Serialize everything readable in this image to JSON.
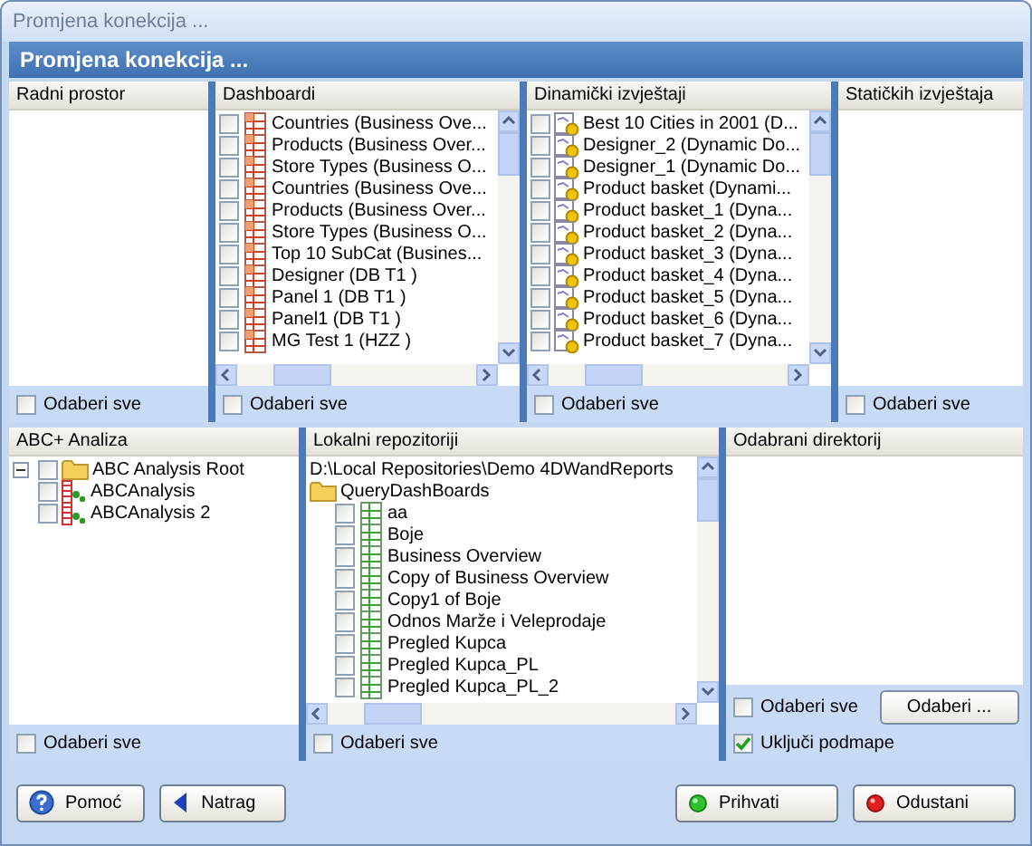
{
  "window": {
    "title": "Promjena konekcija ..."
  },
  "banner": {
    "title": "Promjena konekcija ..."
  },
  "top_panels": [
    {
      "title": "Radni prostor",
      "scrollable": false,
      "select_all": {
        "label": "Odaberi sve",
        "checked": false
      }
    },
    {
      "title": "Dashboardi",
      "scrollable": true,
      "items": [
        {
          "label": "Countries (Business Ove...",
          "kind": "dashboard",
          "checked": false
        },
        {
          "label": "Products (Business Over...",
          "kind": "dashboard",
          "checked": false
        },
        {
          "label": "Store Types (Business O...",
          "kind": "dashboard",
          "checked": false
        },
        {
          "label": "Countries (Business Ove...",
          "kind": "dashboard",
          "checked": false
        },
        {
          "label": "Products (Business Over...",
          "kind": "dashboard",
          "checked": false
        },
        {
          "label": "Store Types (Business O...",
          "kind": "dashboard",
          "checked": false
        },
        {
          "label": "Top 10 SubCat (Busines...",
          "kind": "dashboard",
          "checked": false
        },
        {
          "label": "Designer (DB T1 )",
          "kind": "dashboard",
          "checked": false
        },
        {
          "label": "Panel 1 (DB T1 )",
          "kind": "dashboard",
          "checked": false
        },
        {
          "label": "Panel1 (DB T1 )",
          "kind": "dashboard",
          "checked": false
        },
        {
          "label": "MG Test 1 (HZZ )",
          "kind": "dashboard",
          "checked": false
        }
      ],
      "select_all": {
        "label": "Odaberi sve",
        "checked": false
      }
    },
    {
      "title": "Dinamički izvještaji",
      "scrollable": true,
      "items": [
        {
          "label": "Best 10 Cities in 2001 (D...",
          "kind": "dynamic",
          "checked": false
        },
        {
          "label": "Designer_2 (Dynamic Do...",
          "kind": "dynamic",
          "checked": false
        },
        {
          "label": "Designer_1 (Dynamic Do...",
          "kind": "dynamic",
          "checked": false
        },
        {
          "label": "Product basket (Dynami...",
          "kind": "dynamic",
          "checked": false
        },
        {
          "label": "Product basket_1 (Dyna...",
          "kind": "dynamic",
          "checked": false
        },
        {
          "label": "Product basket_2 (Dyna...",
          "kind": "dynamic",
          "checked": false
        },
        {
          "label": "Product basket_3 (Dyna...",
          "kind": "dynamic",
          "checked": false
        },
        {
          "label": "Product basket_4 (Dyna...",
          "kind": "dynamic",
          "checked": false
        },
        {
          "label": "Product basket_5 (Dyna...",
          "kind": "dynamic",
          "checked": false
        },
        {
          "label": "Product basket_6 (Dyna...",
          "kind": "dynamic",
          "checked": false
        },
        {
          "label": "Product basket_7 (Dyna...",
          "kind": "dynamic",
          "checked": false
        }
      ],
      "select_all": {
        "label": "Odaberi sve",
        "checked": false
      }
    },
    {
      "title": "Statičkih izvještaja",
      "scrollable": false,
      "select_all": {
        "label": "Odaberi sve",
        "checked": false
      }
    }
  ],
  "bottom_panels": [
    {
      "title": "ABC+ Analiza",
      "scrollable": false,
      "items": [
        {
          "label": "ABC Analysis Root",
          "kind": "folder",
          "checked": false,
          "expanded": true,
          "children": [
            {
              "label": "ABCAnalysis",
              "kind": "abc",
              "checked": false
            },
            {
              "label": "ABCAnalysis 2",
              "kind": "abc",
              "checked": false
            }
          ]
        }
      ],
      "select_all": {
        "label": "Odaberi sve",
        "checked": false
      }
    },
    {
      "title": "Lokalni repozitoriji",
      "scrollable": true,
      "path": "D:\\Local Repositories\\Demo 4DWandReports",
      "items": [
        {
          "label": "QueryDashBoards",
          "kind": "folder",
          "children": [
            {
              "label": "aa",
              "kind": "query",
              "checked": false
            },
            {
              "label": "Boje",
              "kind": "query",
              "checked": false
            },
            {
              "label": "Business Overview",
              "kind": "query",
              "checked": false
            },
            {
              "label": "Copy of Business Overview",
              "kind": "query",
              "checked": false
            },
            {
              "label": "Copy1 of Boje",
              "kind": "query",
              "checked": false
            },
            {
              "label": "Odnos Marže i Veleprodaje",
              "kind": "query",
              "checked": false
            },
            {
              "label": "Pregled Kupca",
              "kind": "query",
              "checked": false
            },
            {
              "label": "Pregled Kupca_PL",
              "kind": "query",
              "checked": false
            },
            {
              "label": "Pregled Kupca_PL_2",
              "kind": "query",
              "checked": false
            }
          ]
        }
      ],
      "select_all": {
        "label": "Odaberi sve",
        "checked": false
      }
    },
    {
      "title": "Odabrani direktorij",
      "scrollable": false,
      "select_all": {
        "label": "Odaberi sve",
        "checked": false
      },
      "browse_button": "Odaberi ...",
      "include_subfolders": {
        "label": "Uključi podmape",
        "checked": true
      }
    }
  ],
  "left_buttons": [
    {
      "label": "Pomoć",
      "kind": "help"
    },
    {
      "label": "Natrag",
      "kind": "back"
    }
  ],
  "right_buttons": [
    {
      "label": "Prihvati",
      "kind": "accept"
    },
    {
      "label": "Odustani",
      "kind": "cancel"
    }
  ]
}
